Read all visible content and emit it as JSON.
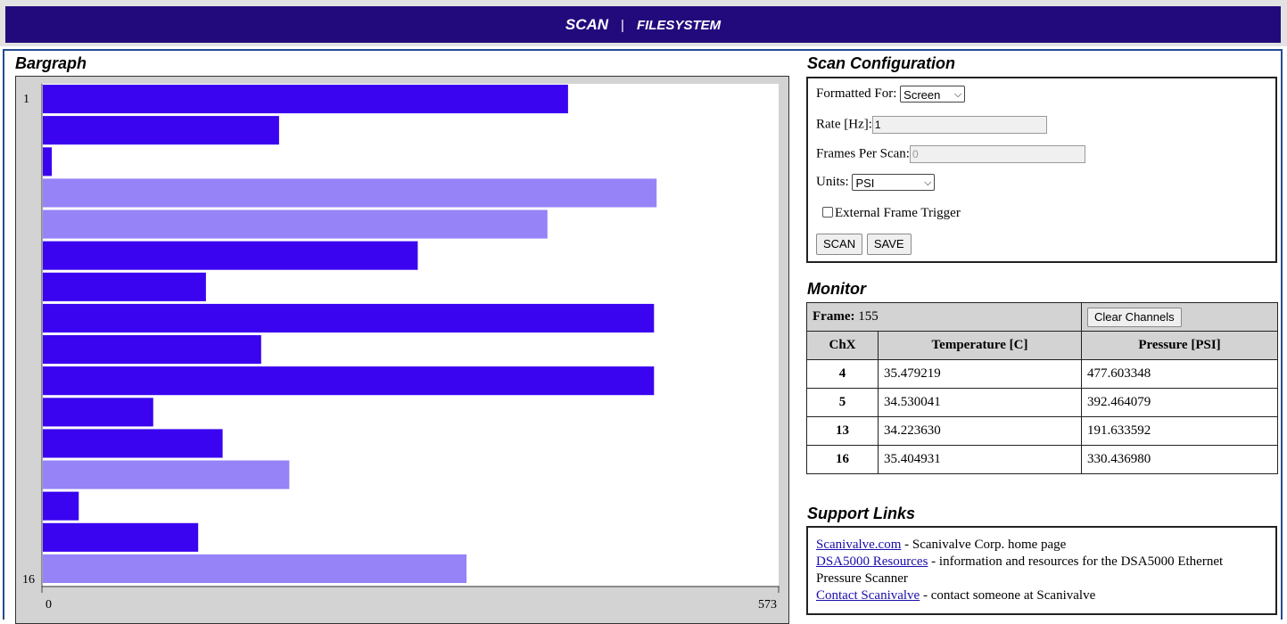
{
  "nav": {
    "scan": "SCAN",
    "separator": "|",
    "filesystem": "FILESYSTEM"
  },
  "colors": {
    "nav_bg": "#230a7c",
    "bar_active": "#3a04f0",
    "bar_light": "#9683f8"
  },
  "bargraph": {
    "title": "Bargraph",
    "first_label": "1",
    "last_label": "16",
    "x_min_label": "0",
    "x_max_label": "573"
  },
  "chart_data": {
    "type": "bar",
    "orientation": "horizontal",
    "categories": [
      "1",
      "2",
      "3",
      "4",
      "5",
      "6",
      "7",
      "8",
      "9",
      "10",
      "11",
      "12",
      "13",
      "14",
      "15",
      "16"
    ],
    "values": [
      409,
      184,
      7,
      478,
      393,
      292,
      127,
      476,
      170,
      476,
      86,
      140,
      192,
      28,
      121,
      330
    ],
    "highlighted": [
      false,
      false,
      false,
      true,
      true,
      false,
      false,
      false,
      false,
      false,
      false,
      false,
      true,
      false,
      false,
      true
    ],
    "xlim": [
      0,
      573
    ]
  },
  "config": {
    "title": "Scan Configuration",
    "formatted_for_label": "Formatted For:",
    "formatted_for_value": "Screen",
    "rate_label": "Rate [Hz]:",
    "rate_value": "1",
    "frames_label": "Frames Per Scan:",
    "frames_value": "0",
    "units_label": "Units:",
    "units_value": "PSI",
    "external_trigger_label": "External Frame Trigger",
    "scan_button": "SCAN",
    "save_button": "SAVE"
  },
  "monitor": {
    "title": "Monitor",
    "frame_label": "Frame:",
    "frame_value": "155",
    "clear_button": "Clear Channels",
    "headers": [
      "ChX",
      "Temperature [C]",
      "Pressure [PSI]"
    ],
    "rows": [
      {
        "ch": "4",
        "temp": "35.479219",
        "pressure": "477.603348"
      },
      {
        "ch": "5",
        "temp": "34.530041",
        "pressure": "392.464079"
      },
      {
        "ch": "13",
        "temp": "34.223630",
        "pressure": "191.633592"
      },
      {
        "ch": "16",
        "temp": "35.404931",
        "pressure": "330.436980"
      }
    ]
  },
  "support": {
    "title": "Support Links",
    "links": [
      {
        "text": "Scanivalve.com",
        "desc": " - Scanivalve Corp. home page"
      },
      {
        "text": "DSA5000 Resources",
        "desc": " - information and resources for the DSA5000 Ethernet Pressure Scanner"
      },
      {
        "text": "Contact Scanivalve",
        "desc": " - contact someone at Scanivalve"
      }
    ]
  }
}
